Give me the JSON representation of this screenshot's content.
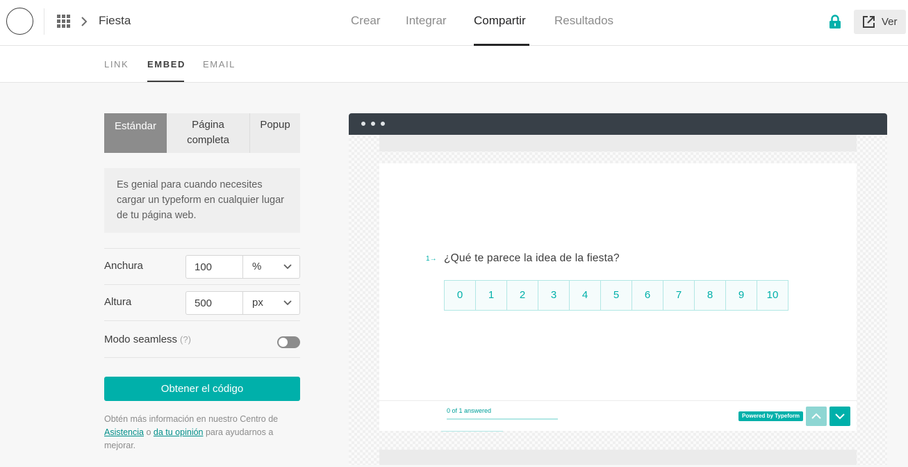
{
  "header": {
    "form_title": "Fiesta",
    "nav": [
      {
        "label": "Crear",
        "active": false
      },
      {
        "label": "Integrar",
        "active": false
      },
      {
        "label": "Compartir",
        "active": true
      },
      {
        "label": "Resultados",
        "active": false
      }
    ],
    "view_button": "Ver",
    "icons": [
      "logo-circle",
      "apps-grid-icon",
      "chevron-right-icon",
      "lock-icon",
      "external-link-icon"
    ],
    "accent_color": "#00b0aa"
  },
  "subnav": {
    "tabs": [
      {
        "label": "LINK",
        "active": false
      },
      {
        "label": "EMBED",
        "active": true
      },
      {
        "label": "EMAIL",
        "active": false
      }
    ]
  },
  "embed": {
    "modes": [
      {
        "label": "Estándar",
        "active": true
      },
      {
        "label": "Página completa",
        "active": false
      },
      {
        "label": "Popup",
        "active": false
      }
    ],
    "description": "Es genial para cuando necesites cargar un typeform en cualquier lugar de tu página web.",
    "width": {
      "label": "Anchura",
      "value": "100",
      "unit": "%"
    },
    "height": {
      "label": "Altura",
      "value": "500",
      "unit": "px"
    },
    "seamless": {
      "label": "Modo seamless",
      "hint": "(?)",
      "enabled": false
    },
    "cta": "Obtener el código",
    "help": {
      "before": "Obtén más información en nuestro Centro de",
      "link1": "Asistencia",
      "middle": "o",
      "link2": "da tu opinión",
      "after": "para ayudarnos a mejorar."
    }
  },
  "preview": {
    "question_number": "1",
    "question_arrow": "→",
    "question": "¿Qué te parece la idea de la fiesta?",
    "scale": [
      "0",
      "1",
      "2",
      "3",
      "4",
      "5",
      "6",
      "7",
      "8",
      "9",
      "10"
    ],
    "progress_text": "0 of 1 answered",
    "progress_fraction": 0,
    "powered_by": "Powered by Typeform"
  }
}
